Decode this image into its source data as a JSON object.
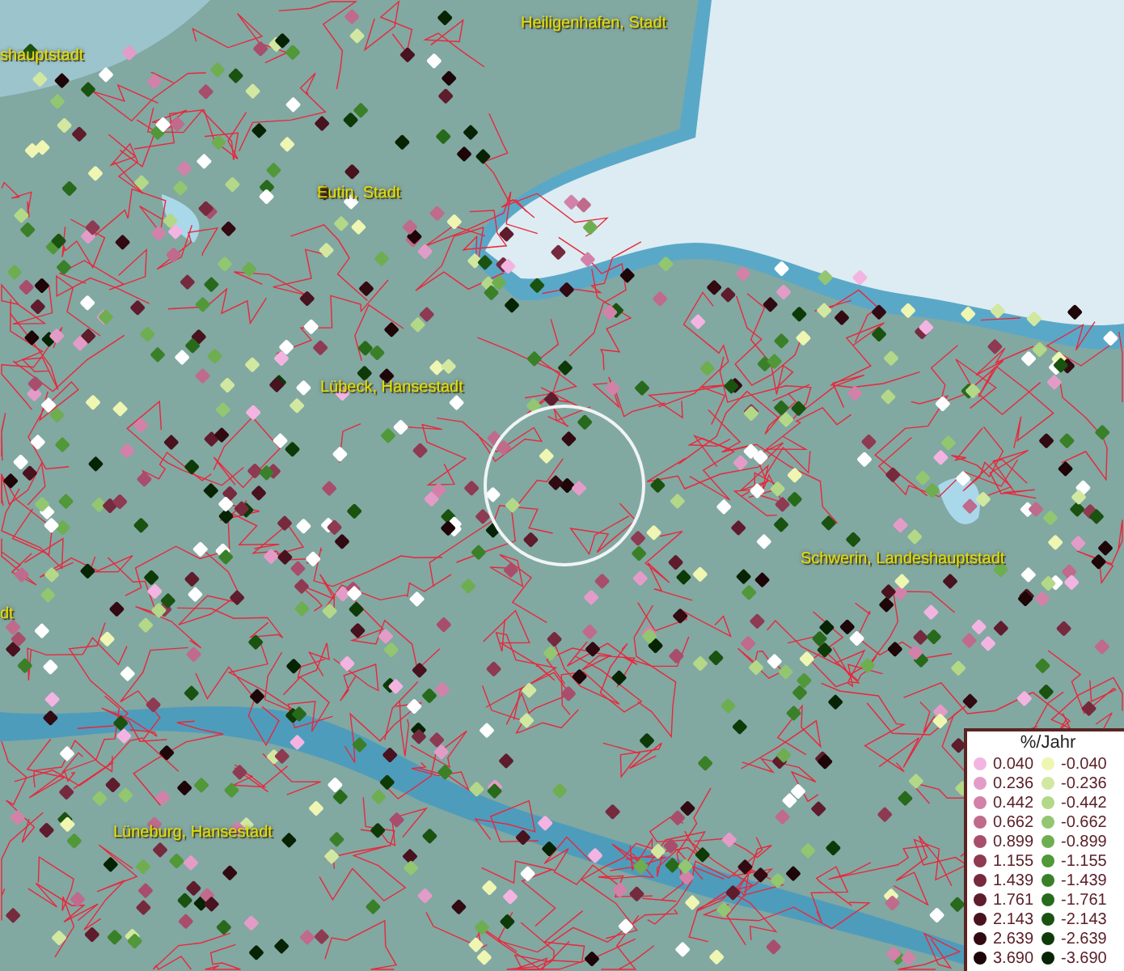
{
  "map": {
    "place_labels": [
      {
        "text": "Heiligenhafen, Stadt"
      },
      {
        "text": "shauptstadt"
      },
      {
        "text": "Eutin, Stadt"
      },
      {
        "text": "Lübeck, Hansestadt"
      },
      {
        "text": "Schwerin, Landeshauptstadt"
      },
      {
        "text": "dt"
      },
      {
        "text": "Lüneburg, Hansestadt"
      }
    ]
  },
  "legend": {
    "title": "%/Jahr",
    "items": [
      {
        "label": "0.040",
        "color": "#f4b4e2"
      },
      {
        "label": "-0.040",
        "color": "#eef6b2"
      },
      {
        "label": "0.236",
        "color": "#e39cc8"
      },
      {
        "label": "-0.236",
        "color": "#d2e8a0"
      },
      {
        "label": "0.442",
        "color": "#d282a8"
      },
      {
        "label": "-0.442",
        "color": "#b2d888"
      },
      {
        "label": "0.662",
        "color": "#c06a8c"
      },
      {
        "label": "-0.662",
        "color": "#92c670"
      },
      {
        "label": "0.899",
        "color": "#a84e6c"
      },
      {
        "label": "-0.899",
        "color": "#6eae50"
      },
      {
        "label": "1.155",
        "color": "#8e3a52"
      },
      {
        "label": "-1.155",
        "color": "#509838"
      },
      {
        "label": "1.439",
        "color": "#762a3e"
      },
      {
        "label": "-1.439",
        "color": "#3a8028"
      },
      {
        "label": "1.761",
        "color": "#5e1c2c"
      },
      {
        "label": "-1.761",
        "color": "#286a1c"
      },
      {
        "label": "2.143",
        "color": "#48121e"
      },
      {
        "label": "-2.143",
        "color": "#1a5210"
      },
      {
        "label": "2.639",
        "color": "#320a12"
      },
      {
        "label": "-2.639",
        "color": "#0e3a08"
      },
      {
        "label": "3.690",
        "color": "#1e0508"
      },
      {
        "label": "-3.690",
        "color": "#062404"
      }
    ]
  }
}
